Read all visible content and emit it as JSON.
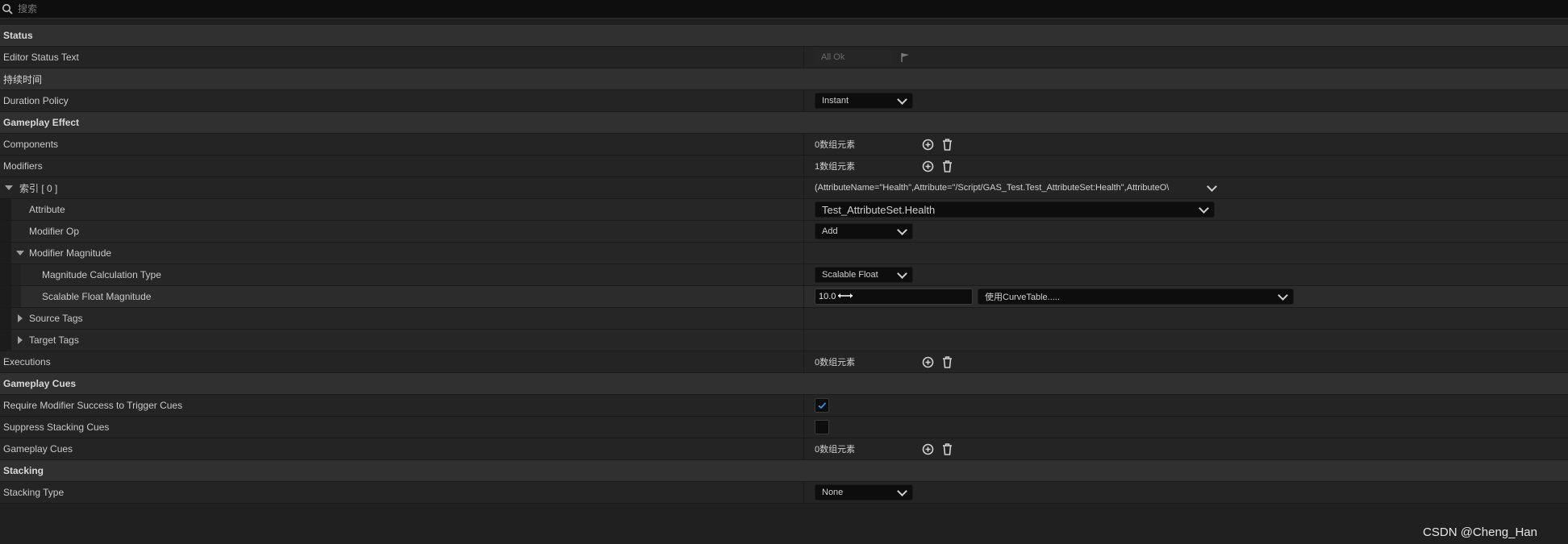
{
  "search": {
    "placeholder": "搜索"
  },
  "rows": {
    "status_header": "Status",
    "editor_status_label": "Editor Status Text",
    "editor_status_value": "All Ok",
    "duration_header": "持续时间",
    "duration_policy_label": "Duration Policy",
    "duration_policy_value": "Instant",
    "gameplay_effect_header": "Gameplay Effect",
    "components_label": "Components",
    "components_count": "0数组元素",
    "modifiers_label": "Modifiers",
    "modifiers_count": "1数组元素",
    "index0_label": "索引 [ 0 ]",
    "index0_value": "(AttributeName=\"Health\",Attribute=\"/Script/GAS_Test.Test_AttributeSet:Health\",AttributeO\\",
    "attribute_label": "Attribute",
    "attribute_value": "Test_AttributeSet.Health",
    "modifier_op_label": "Modifier Op",
    "modifier_op_value": "Add",
    "modifier_magnitude_label": "Modifier Magnitude",
    "calc_type_label": "Magnitude Calculation Type",
    "calc_type_value": "Scalable Float",
    "scalable_label": "Scalable Float Magnitude",
    "scalable_value": "10.0",
    "curve_table_value": "使用CurveTable.....",
    "source_tags_label": "Source Tags",
    "target_tags_label": "Target Tags",
    "executions_label": "Executions",
    "executions_count": "0数组元素",
    "gameplay_cues_header": "Gameplay Cues",
    "require_success_label": "Require Modifier Success to Trigger Cues",
    "require_success_checked": true,
    "suppress_stacking_label": "Suppress Stacking Cues",
    "suppress_stacking_checked": false,
    "gameplay_cues_label": "Gameplay Cues",
    "gameplay_cues_count": "0数组元素",
    "stacking_header": "Stacking",
    "stacking_type_label": "Stacking Type",
    "stacking_type_value": "None"
  },
  "watermark": "CSDN @Cheng_Han",
  "colors": {
    "background": "#202020",
    "category": "#303030",
    "checkbox_accent": "#3a8ee6"
  }
}
